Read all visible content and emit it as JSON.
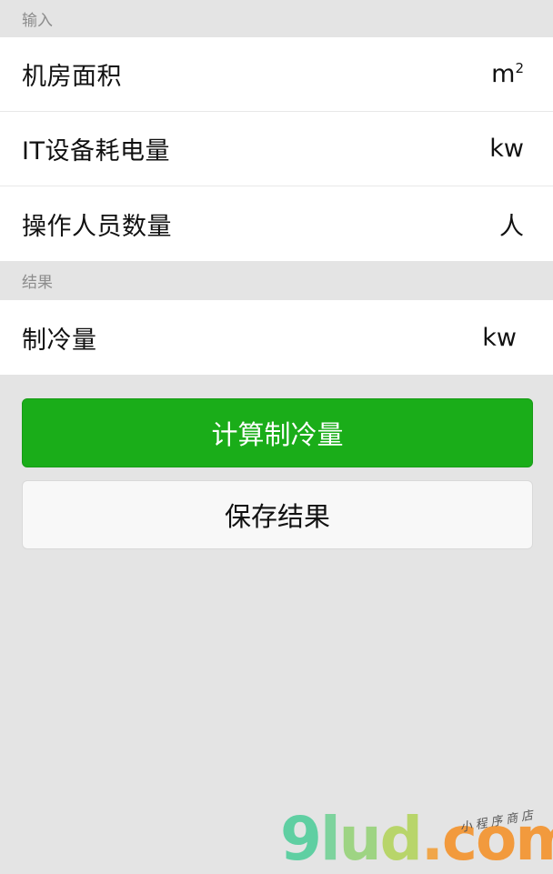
{
  "input_section": {
    "title": "输入",
    "rows": [
      {
        "label": "机房面积",
        "unit": "m",
        "unit_sup": "2"
      },
      {
        "label": "IT设备耗电量",
        "unit": "kw"
      },
      {
        "label": "操作人员数量",
        "unit": "人"
      }
    ]
  },
  "result_section": {
    "title": "结果",
    "rows": [
      {
        "label": "制冷量",
        "unit": "kw"
      }
    ]
  },
  "buttons": {
    "calculate_label": "计算制冷量",
    "save_label": "保存结果"
  },
  "watermark": {
    "brand_g": "9",
    "brand_l": "l",
    "brand_u": "u",
    "brand_d": "d",
    "brand_dot": ".",
    "brand_com": "com",
    "tagline": "小程序商店"
  },
  "colors": {
    "primary_button": "#1aad19",
    "background": "#e4e4e4"
  }
}
